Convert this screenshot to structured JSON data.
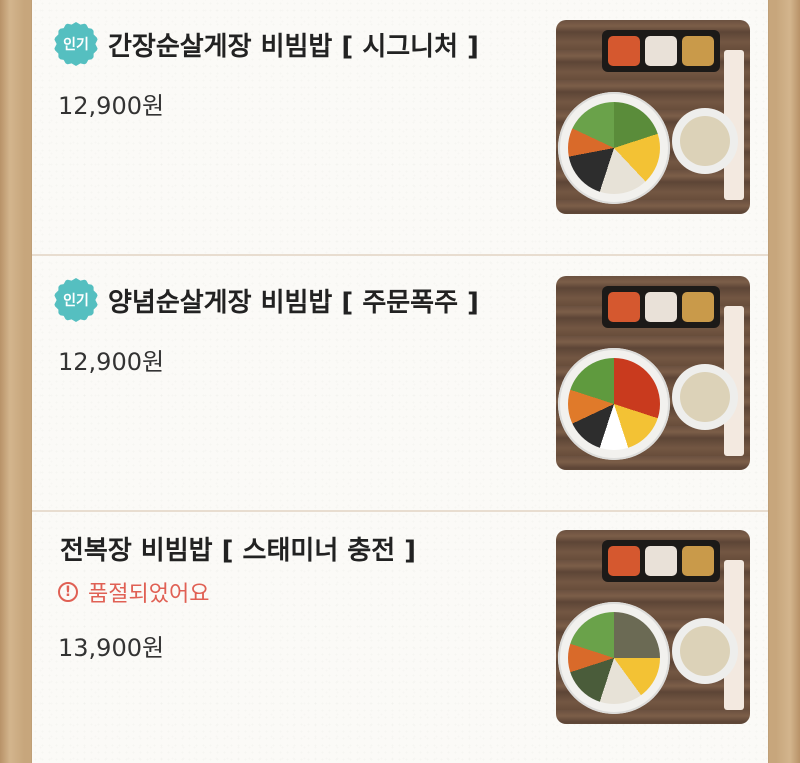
{
  "items": [
    {
      "badge": "인기",
      "title": "간장순살게장 비빔밥 [ 시그니처 ]",
      "price": "12,900원"
    },
    {
      "badge": "인기",
      "title": "양념순살게장 비빔밥 [ 주문폭주 ]",
      "price": "12,900원"
    },
    {
      "title": "전복장 비빔밥 [ 스태미너 충전 ]",
      "status": "품절되었어요",
      "price": "13,900원"
    }
  ],
  "colors": {
    "badge": "#55bfc0",
    "soldout": "#e06054",
    "frame": "#c7a67c"
  },
  "icons": {
    "soldout": "warning-circle-icon",
    "badge_shape": "scalloped-circle"
  }
}
